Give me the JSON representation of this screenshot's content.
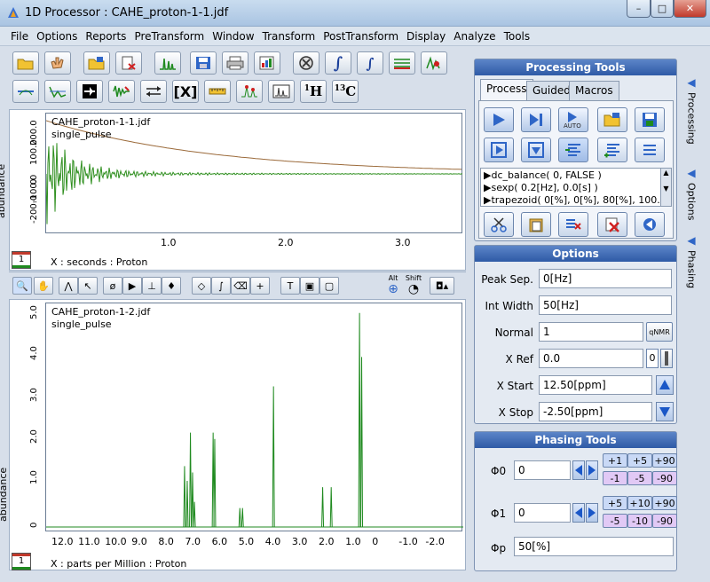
{
  "window": {
    "title": "1D Processor : CAHE_proton-1-1.jdf"
  },
  "menu": [
    "File",
    "Options",
    "Reports",
    "PreTransform",
    "Window",
    "Transform",
    "PostTransform",
    "Display",
    "Analyze",
    "Tools"
  ],
  "top_plot": {
    "filename": "CAHE_proton-1-1.jdf",
    "pulse": "single_pulse",
    "ylabel": "abundance",
    "xlabel": "X : seconds : Proton",
    "page": "1",
    "yticks": [
      "200.0",
      "100.0",
      "0",
      "-100.0",
      "-200.0"
    ],
    "xticks": [
      "1.0",
      "2.0",
      "3.0"
    ]
  },
  "bottom_plot": {
    "filename": "CAHE_proton-1-2.jdf",
    "pulse": "single_pulse",
    "ylabel": "abundance",
    "xlabel": "X : parts per Million : Proton",
    "page": "1",
    "yticks": [
      "5.0",
      "4.0",
      "3.0",
      "2.0",
      "1.0",
      "0"
    ],
    "xticks": [
      "12.0",
      "11.0",
      "10.0",
      "9.0",
      "8.0",
      "7.0",
      "6.0",
      "5.0",
      "4.0",
      "3.0",
      "2.0",
      "1.0",
      "0",
      "-1.0",
      "-2.0"
    ],
    "alt_label": "Alt",
    "shift_label": "Shift"
  },
  "processing": {
    "header": "Processing Tools",
    "tabs": [
      "Process",
      "Guided",
      "Macros"
    ],
    "active_tab": "Process",
    "macros": [
      "▶dc_balance( 0, FALSE )",
      "▶sexp( 0.2[Hz], 0.0[s] )",
      "▶trapezoid( 0[%], 0[%], 80[%], 100..."
    ]
  },
  "options": {
    "header": "Options",
    "peak_sep_label": "Peak Sep.",
    "peak_sep": "0[Hz]",
    "int_width_label": "Int Width",
    "int_width": "50[Hz]",
    "normal_label": "Normal",
    "normal": "1",
    "qnmr": "qNMR",
    "xref_label": "X Ref",
    "xref": "0.0",
    "xref_btn": "0",
    "xstart_label": "X Start",
    "xstart": "12.50[ppm]",
    "xstop_label": "X Stop",
    "xstop": "-2.50[ppm]"
  },
  "phasing": {
    "header": "Phasing Tools",
    "phi0_label": "Φ0",
    "phi0": "0",
    "phi1_label": "Φ1",
    "phi1": "0",
    "phip_label": "Φp",
    "phip": "50[%]",
    "phi0_plus": [
      "+1",
      "+5",
      "+90"
    ],
    "phi0_minus": [
      "-1",
      "-5",
      "-90"
    ],
    "phi1_plus": [
      "+5",
      "+10",
      "+90"
    ],
    "phi1_minus": [
      "-5",
      "-10",
      "-90"
    ]
  },
  "side_tabs": [
    "Processing",
    "Options",
    "Phasing"
  ],
  "toolbar": {
    "h_label": "1H",
    "c_label": "13C"
  },
  "colors": {
    "header_blue": "#2e5aa6",
    "fid_green": "#2f8f1f",
    "spectrum_green": "#1f8a1f",
    "decay_brown": "#9b6a3a"
  }
}
